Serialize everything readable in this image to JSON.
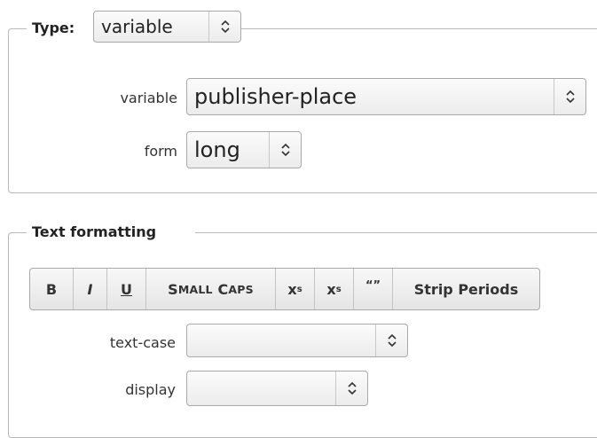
{
  "type_section": {
    "legend": "Type:",
    "type_select_value": "variable",
    "variable_label": "variable",
    "variable_value": "publisher-place",
    "form_label": "form",
    "form_value": "long"
  },
  "format_section": {
    "legend": "Text formatting",
    "toolbar": {
      "bold": "B",
      "italic": "I",
      "underline": "U",
      "small_caps_s": "S",
      "small_caps_mall": "MALL",
      "small_caps_c": "C",
      "small_caps_aps": "APS",
      "superscript_base": "x",
      "superscript_exp": "s",
      "subscript_base": "x",
      "subscript_sub": "s",
      "quotes": "“”",
      "strip_periods": "Strip Periods"
    },
    "text_case_label": "text-case",
    "text_case_value": "",
    "display_label": "display",
    "display_value": ""
  },
  "icons": {
    "select_arrow": "up-down-chevron-icon"
  }
}
